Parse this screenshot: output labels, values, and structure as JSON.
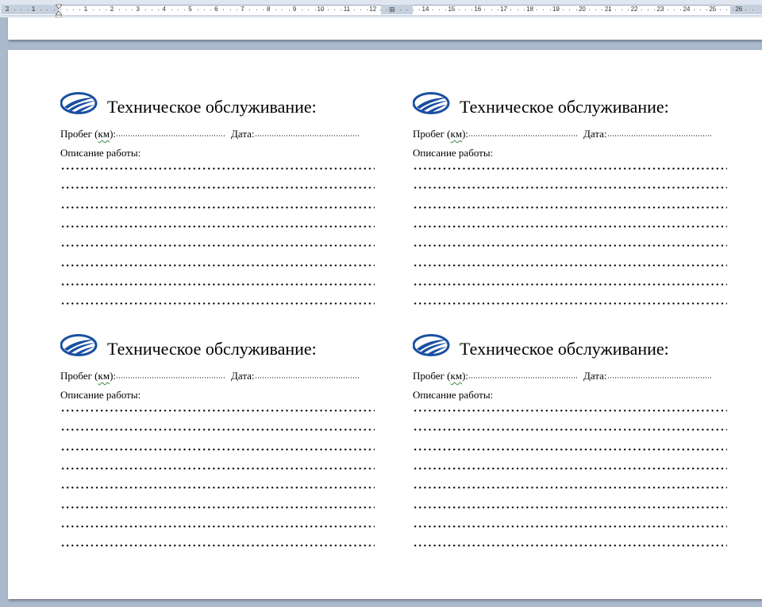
{
  "ruler": {
    "numbers_left": [
      "2",
      "1",
      "1",
      "2",
      "3",
      "4",
      "5",
      "6",
      "7",
      "8",
      "9",
      "10",
      "11",
      "12"
    ],
    "numbers_right": [
      "14",
      "15",
      "16",
      "17",
      "18",
      "19",
      "20",
      "21",
      "22",
      "23",
      "24",
      "25",
      "26"
    ],
    "column_marker": "⊞"
  },
  "cards": [
    {
      "title": "Техническое обслуживание:",
      "mileage_label_prefix": "Пробег (",
      "mileage_unit": "км",
      "mileage_label_suffix": "):",
      "date_label": "Дата:",
      "description_label": "Описание работы:"
    },
    {
      "title": "Техническое обслуживание:",
      "mileage_label_prefix": "Пробег (",
      "mileage_unit": "км",
      "mileage_label_suffix": "):",
      "date_label": "Дата:",
      "description_label": "Описание работы:"
    },
    {
      "title": "Техническое обслуживание:",
      "mileage_label_prefix": "Пробег (",
      "mileage_unit": "км",
      "mileage_label_suffix": "):",
      "date_label": "Дата:",
      "description_label": "Описание работы:"
    },
    {
      "title": "Техническое обслуживание:",
      "mileage_label_prefix": "Пробег (",
      "mileage_unit": "км",
      "mileage_label_suffix": "):",
      "date_label": "Дата:",
      "description_label": "Описание работы:"
    }
  ],
  "colors": {
    "logo_blue": "#1a4fa0",
    "spellcheck_green": "#3a8a3a"
  },
  "icons": {
    "logo": "ellipse-swoosh-logo-icon",
    "indent": "indent-marker-icon"
  }
}
